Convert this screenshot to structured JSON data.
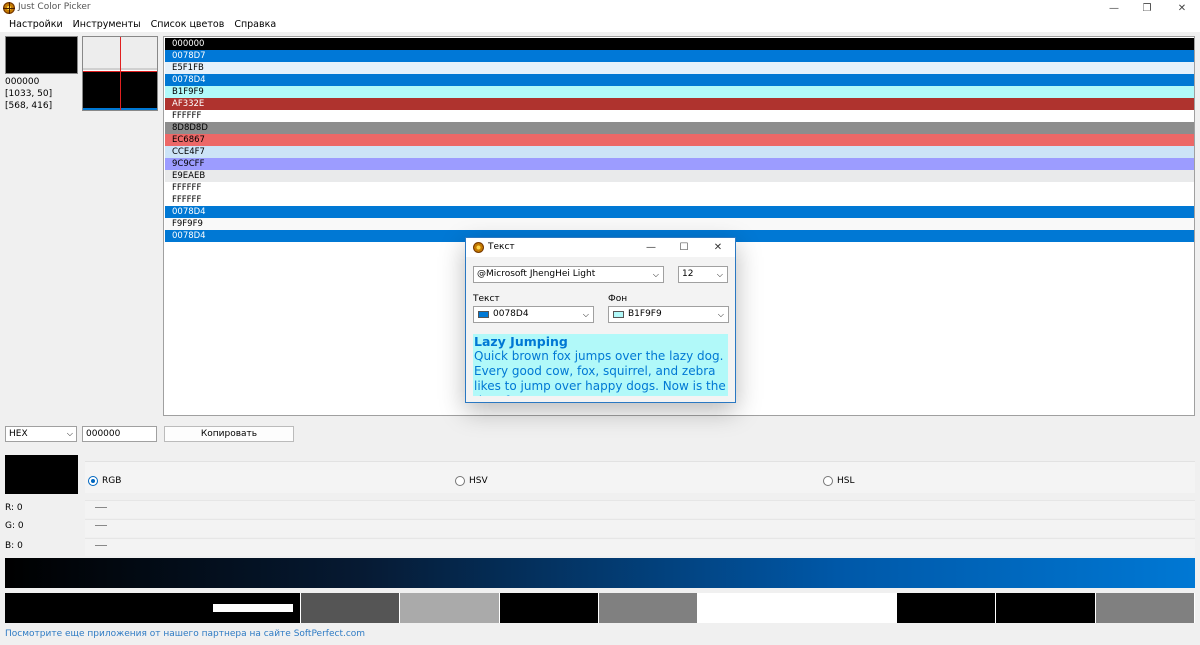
{
  "window": {
    "title": "Just Color Picker"
  },
  "menu": [
    "Настройки",
    "Инструменты",
    "Список цветов",
    "Справка"
  ],
  "info": {
    "hex": "000000",
    "coord1": "[1033, 50]",
    "coord2": "[568, 416]"
  },
  "colors": {
    "black": "#000000",
    "accent": "#0078D4",
    "list_selection": "#0067C0",
    "text_light": "#FFFFFF",
    "text_dark": "#000000"
  },
  "color_list": [
    {
      "label": "000000",
      "color": "#000000"
    },
    {
      "label": "0078D7",
      "color": "#0078D7"
    },
    {
      "label": "E5F1FB",
      "color": "#E5F1FB"
    },
    {
      "label": "0078D4",
      "color": "#0078D4"
    },
    {
      "label": "B1F9F9",
      "color": "#B1F9F9"
    },
    {
      "label": "AF332E",
      "color": "#AF332E"
    },
    {
      "label": "FFFFFF",
      "color": "#FFFFFF"
    },
    {
      "label": "8D8D8D",
      "color": "#8D8D8D"
    },
    {
      "label": "EC6867",
      "color": "#EC6867"
    },
    {
      "label": "CCE4F7",
      "color": "#CCE4F7"
    },
    {
      "label": "9C9CFF",
      "color": "#9C9CFF"
    },
    {
      "label": "E9EAEB",
      "color": "#E9EAEB"
    },
    {
      "label": "FFFFFF",
      "color": "#FFFFFF"
    },
    {
      "label": "FFFFFF",
      "color": "#FFFFFF"
    },
    {
      "label": "0078D4",
      "color": "#0078D4"
    },
    {
      "label": "F9F9F9",
      "color": "#F9F9F9"
    },
    {
      "label": "0078D4",
      "color": "#0078D4"
    }
  ],
  "code": {
    "format": "HEX",
    "value": "000000",
    "copy_label": "Копировать"
  },
  "models": {
    "rgb": "RGB",
    "hsv": "HSV",
    "hsl": "HSL",
    "selected": "RGB"
  },
  "channels": [
    {
      "label": "R: 0"
    },
    {
      "label": "G: 0"
    },
    {
      "label": "B: 0"
    }
  ],
  "palette": [
    "#000000",
    "#000000",
    "#000000",
    "#555555",
    "#AAAAAA",
    "#000000",
    "#808080",
    "#FFFFFF",
    "#FFFFFF",
    "#000000",
    "#000000",
    "#808080"
  ],
  "footer": "Посмотрите еще приложения от нашего партнера на сайте SoftPerfect.com",
  "dialog": {
    "title": "Текст",
    "font": "@Microsoft JhengHei Light",
    "size": "12",
    "text_label": "Текст",
    "bg_label": "Фон",
    "text_color": "0078D4",
    "text_color_hex": "#0078D4",
    "bg_color": "B1F9F9",
    "bg_color_hex": "#B1F9F9",
    "sample_heading": "Lazy Jumping",
    "sample_body": "Quick brown fox jumps over the lazy dog. Every good cow, fox, squirrel, and zebra likes to jump over happy dogs. Now is the time for"
  }
}
